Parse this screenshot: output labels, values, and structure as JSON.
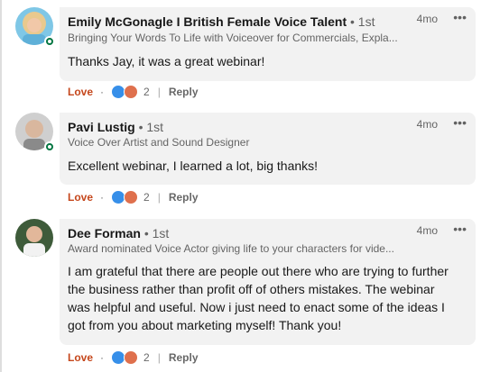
{
  "comments": [
    {
      "name": "Emily McGonagle I British Female Voice Talent",
      "degree": "• 1st",
      "headline": "Bringing Your Words To Life with Voiceover for Commercials, Expla...",
      "time": "4mo",
      "more": "•••",
      "text": "Thanks Jay, it was a great webinar!",
      "love_label": "Love",
      "reaction_count": "2",
      "reply_label": "Reply",
      "online": true
    },
    {
      "name": "Pavi Lustig",
      "degree": "• 1st",
      "headline": "Voice Over Artist and Sound Designer",
      "time": "4mo",
      "more": "•••",
      "text": "Excellent webinar, I learned a lot, big thanks!",
      "love_label": "Love",
      "reaction_count": "2",
      "reply_label": "Reply",
      "online": true
    },
    {
      "name": "Dee Forman",
      "degree": "• 1st",
      "headline": "Award nominated Voice Actor giving life to your characters for vide...",
      "time": "4mo",
      "more": "•••",
      "text": "I am grateful that there are people out there who are trying to further the business rather than profit off of others mistakes. The webinar was helpful and useful. Now i just need to enact some of the ideas I got from you about marketing myself! Thank you!",
      "love_label": "Love",
      "reaction_count": "2",
      "reply_label": "Reply",
      "online": false
    }
  ],
  "colors": {
    "bubble": "#f2f2f2",
    "love": "#c5471c",
    "like_reaction": "#378fe9",
    "heart_reaction": "#df704d",
    "online": "#057642"
  }
}
